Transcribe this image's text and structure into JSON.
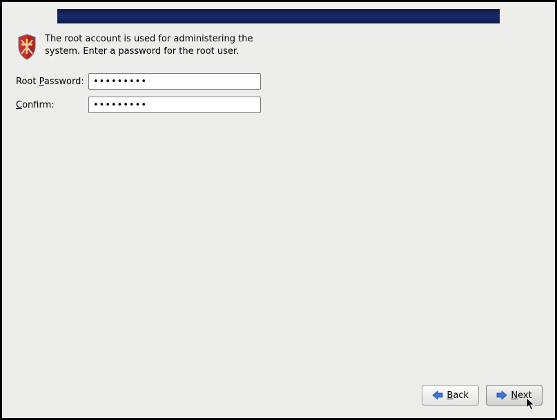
{
  "intro": {
    "text": "The root account is used for administering the system.  Enter a password for the root user."
  },
  "form": {
    "password_label_pre": "Root ",
    "password_label_u": "P",
    "password_label_post": "assword:",
    "password_value": "•••••••••",
    "confirm_label_u": "C",
    "confirm_label_post": "onfirm:",
    "confirm_value": "•••••••••"
  },
  "buttons": {
    "back_u": "B",
    "back_post": "ack",
    "next_u": "N",
    "next_post": "ext"
  }
}
